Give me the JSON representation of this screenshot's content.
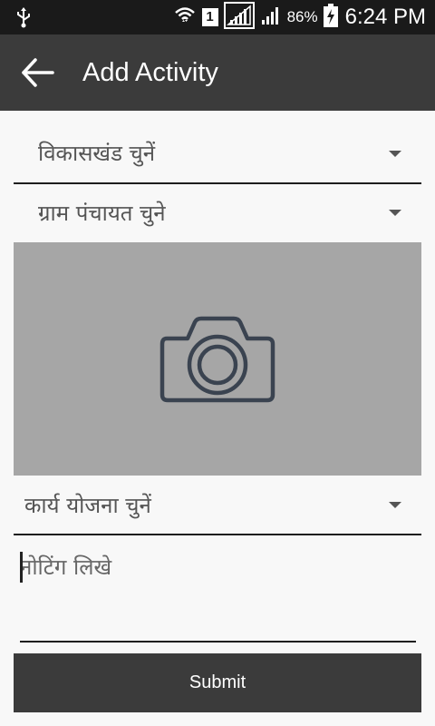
{
  "status_bar": {
    "battery_percent": "86%",
    "time": "6:24 PM",
    "sim_slot": "1",
    "icons": [
      "usb-icon",
      "wifi-icon",
      "sim-icon",
      "signal-icon",
      "signal-icon",
      "battery-charging-icon"
    ]
  },
  "app_bar": {
    "title": "Add Activity",
    "back_icon": "arrow-back-icon"
  },
  "form": {
    "block_select": {
      "label": "विकासखंड चुनें",
      "icon": "dropdown-caret-icon"
    },
    "panchayat_select": {
      "label": "ग्राम पंचायत चुने",
      "icon": "dropdown-caret-icon"
    },
    "photo": {
      "icon": "camera-icon",
      "background": "#a6a6a6"
    },
    "work_plan_select": {
      "label": "कार्य योजना चुनें",
      "icon": "dropdown-caret-icon"
    },
    "notes": {
      "placeholder": "नोटिंग लिखे"
    },
    "submit_label": "Submit"
  },
  "colors": {
    "app_bar": "#3b3b3b",
    "status_bar": "#1a1a1a",
    "background": "#f8f8f8",
    "submit_button": "#3b3b3b"
  }
}
